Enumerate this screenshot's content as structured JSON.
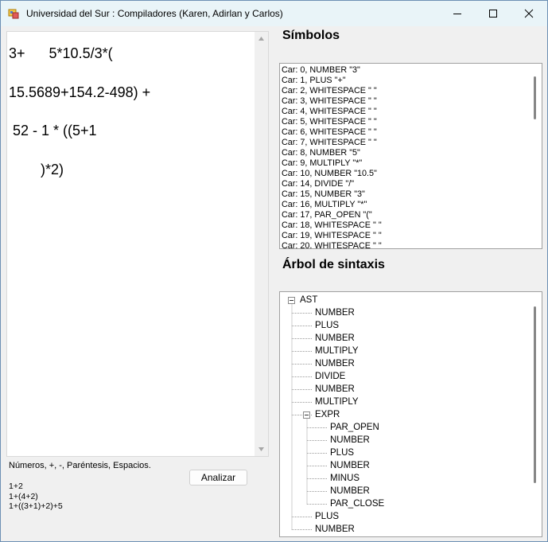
{
  "window": {
    "title": "Universidad del Sur : Compiladores (Karen, Adirlan y Carlos)",
    "icon": "app-icon"
  },
  "editor": {
    "text": "3+      5*10.5/3*(\n15.5689+154.2-498) +\n 52 - 1 * ((5+1\n        )*2)"
  },
  "hint": "Números, +, -, Paréntesis, Espacios.",
  "examples": [
    "1+2",
    "1+(4+2)",
    "1+((3+1)+2)+5"
  ],
  "analyze_button": "Analizar",
  "symbols": {
    "title": "Símbolos",
    "items": [
      "Car: 0, NUMBER \"3\"",
      "Car: 1, PLUS \"+\"",
      "Car: 2, WHITESPACE \" \"",
      "Car: 3, WHITESPACE \" \"",
      "Car: 4, WHITESPACE \" \"",
      "Car: 5, WHITESPACE \" \"",
      "Car: 6, WHITESPACE \" \"",
      "Car: 7, WHITESPACE \" \"",
      "Car: 8, NUMBER \"5\"",
      "Car: 9, MULTIPLY \"*\"",
      "Car: 10, NUMBER \"10.5\"",
      "Car: 14, DIVIDE \"/\"",
      "Car: 15, NUMBER \"3\"",
      "Car: 16, MULTIPLY \"*\"",
      "Car: 17, PAR_OPEN \"(\"",
      "Car: 18, WHITESPACE \" \"",
      "Car: 19, WHITESPACE \" \"",
      "Car: 20, WHITESPACE \" \""
    ]
  },
  "tree": {
    "title": "Árbol de sintaxis",
    "nodes": [
      {
        "label": "AST",
        "depth": 0,
        "expander": true
      },
      {
        "label": "NUMBER",
        "depth": 1
      },
      {
        "label": "PLUS",
        "depth": 1
      },
      {
        "label": "NUMBER",
        "depth": 1
      },
      {
        "label": "MULTIPLY",
        "depth": 1
      },
      {
        "label": "NUMBER",
        "depth": 1
      },
      {
        "label": "DIVIDE",
        "depth": 1
      },
      {
        "label": "NUMBER",
        "depth": 1
      },
      {
        "label": "MULTIPLY",
        "depth": 1
      },
      {
        "label": "EXPR",
        "depth": 1,
        "expander": true
      },
      {
        "label": "PAR_OPEN",
        "depth": 2
      },
      {
        "label": "NUMBER",
        "depth": 2
      },
      {
        "label": "PLUS",
        "depth": 2
      },
      {
        "label": "NUMBER",
        "depth": 2
      },
      {
        "label": "MINUS",
        "depth": 2
      },
      {
        "label": "NUMBER",
        "depth": 2
      },
      {
        "label": "PAR_CLOSE",
        "depth": 2
      },
      {
        "label": "PLUS",
        "depth": 1
      },
      {
        "label": "NUMBER",
        "depth": 1
      }
    ]
  }
}
